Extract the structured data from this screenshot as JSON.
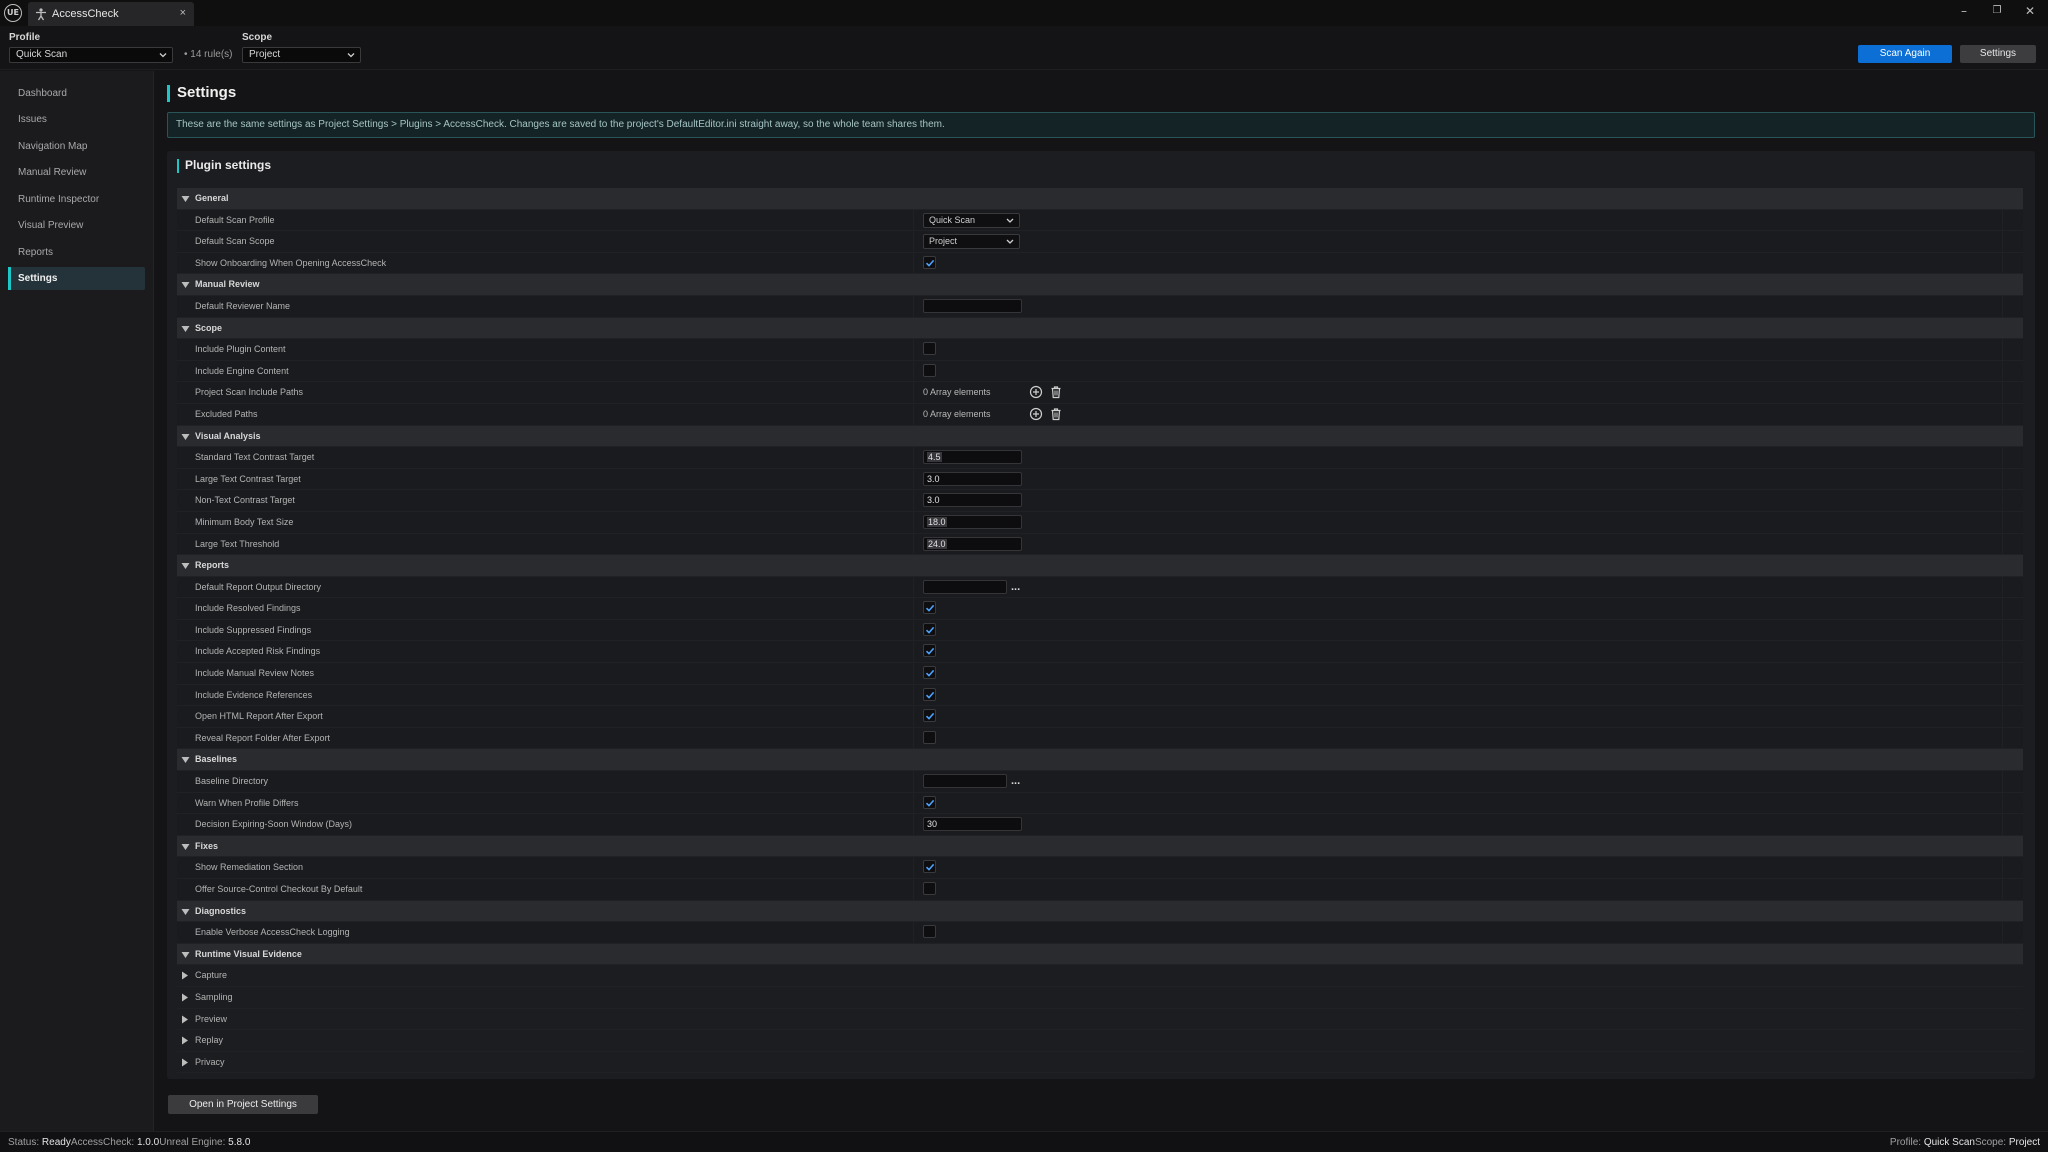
{
  "window": {
    "logo_text": "UE",
    "tab_title": "AccessCheck",
    "tab_close": "×",
    "minimize": "–",
    "restore": "❐",
    "close": "✕"
  },
  "toolbar": {
    "profile_label": "Profile",
    "profile_value": "Quick Scan",
    "rule_count": "• 14 rule(s)",
    "scope_label": "Scope",
    "scope_value": "Project",
    "scan_again": "Scan Again",
    "settings": "Settings"
  },
  "sidebar": {
    "items": [
      {
        "label": "Dashboard"
      },
      {
        "label": "Issues"
      },
      {
        "label": "Navigation Map"
      },
      {
        "label": "Manual Review"
      },
      {
        "label": "Runtime Inspector"
      },
      {
        "label": "Visual Preview"
      },
      {
        "label": "Reports"
      },
      {
        "label": "Settings",
        "active": true
      }
    ]
  },
  "main": {
    "title": "Settings",
    "banner": "These are the same settings as Project Settings > Plugins > AccessCheck. Changes are saved to the project's DefaultEditor.ini straight away, so the whole team shares them.",
    "panel_title": "Plugin settings",
    "open_button": "Open in Project Settings"
  },
  "settings": {
    "general": {
      "label": "General",
      "default_scan_profile": {
        "label": "Default Scan Profile",
        "value": "Quick Scan"
      },
      "default_scan_scope": {
        "label": "Default Scan Scope",
        "value": "Project"
      },
      "show_onboarding": {
        "label": "Show Onboarding When Opening AccessCheck",
        "checked": true
      }
    },
    "manual_review": {
      "label": "Manual Review",
      "default_reviewer_name": {
        "label": "Default Reviewer Name",
        "value": ""
      }
    },
    "scope": {
      "label": "Scope",
      "include_plugin_content": {
        "label": "Include Plugin Content",
        "checked": false
      },
      "include_engine_content": {
        "label": "Include Engine Content",
        "checked": false
      },
      "project_scan_include_paths": {
        "label": "Project Scan Include Paths",
        "value": "0 Array elements"
      },
      "excluded_paths": {
        "label": "Excluded Paths",
        "value": "0 Array elements"
      }
    },
    "visual_analysis": {
      "label": "Visual Analysis",
      "standard_text_contrast": {
        "label": "Standard Text Contrast Target",
        "value": "4.5"
      },
      "large_text_contrast": {
        "label": "Large Text Contrast Target",
        "value": "3.0"
      },
      "non_text_contrast": {
        "label": "Non-Text Contrast Target",
        "value": "3.0"
      },
      "min_body_text_size": {
        "label": "Minimum Body Text Size",
        "value": "18.0"
      },
      "large_text_threshold": {
        "label": "Large Text Threshold",
        "value": "24.0"
      }
    },
    "reports": {
      "label": "Reports",
      "output_directory": {
        "label": "Default Report Output Directory",
        "value": ""
      },
      "include_resolved": {
        "label": "Include Resolved Findings",
        "checked": true
      },
      "include_suppressed": {
        "label": "Include Suppressed Findings",
        "checked": true
      },
      "include_accepted_risk": {
        "label": "Include Accepted Risk Findings",
        "checked": true
      },
      "include_manual_review_notes": {
        "label": "Include Manual Review Notes",
        "checked": true
      },
      "include_evidence_references": {
        "label": "Include Evidence References",
        "checked": true
      },
      "open_html_report": {
        "label": "Open HTML Report After Export",
        "checked": true
      },
      "reveal_report_folder": {
        "label": "Reveal Report Folder After Export",
        "checked": false
      }
    },
    "baselines": {
      "label": "Baselines",
      "baseline_directory": {
        "label": "Baseline Directory",
        "value": ""
      },
      "warn_profile_differs": {
        "label": "Warn When Profile Differs",
        "checked": true
      },
      "expiring_soon_window": {
        "label": "Decision Expiring-Soon Window (Days)",
        "value": "30"
      }
    },
    "fixes": {
      "label": "Fixes",
      "show_remediation": {
        "label": "Show Remediation Section",
        "checked": true
      },
      "offer_checkout": {
        "label": "Offer Source-Control Checkout By Default",
        "checked": false
      }
    },
    "diagnostics": {
      "label": "Diagnostics",
      "verbose_logging": {
        "label": "Enable Verbose AccessCheck Logging",
        "checked": false
      }
    },
    "runtime_visual_evidence": {
      "label": "Runtime Visual Evidence",
      "subsections": [
        "Capture",
        "Sampling",
        "Preview",
        "Replay",
        "Privacy"
      ]
    },
    "browse_dots": "..."
  },
  "status": {
    "status_label": "Status:",
    "status_value": "Ready",
    "version_label": "AccessCheck:",
    "version_value": "1.0.0",
    "engine_label": "Unreal Engine:",
    "engine_value": "5.8.0",
    "profile_label": "Profile:",
    "profile_value": "Quick Scan",
    "scope_label": "Scope:",
    "scope_value": "Project"
  },
  "colors": {
    "accent": "#1ec7c7",
    "primary_button": "#0b6fd6",
    "check": "#4da3ff"
  }
}
